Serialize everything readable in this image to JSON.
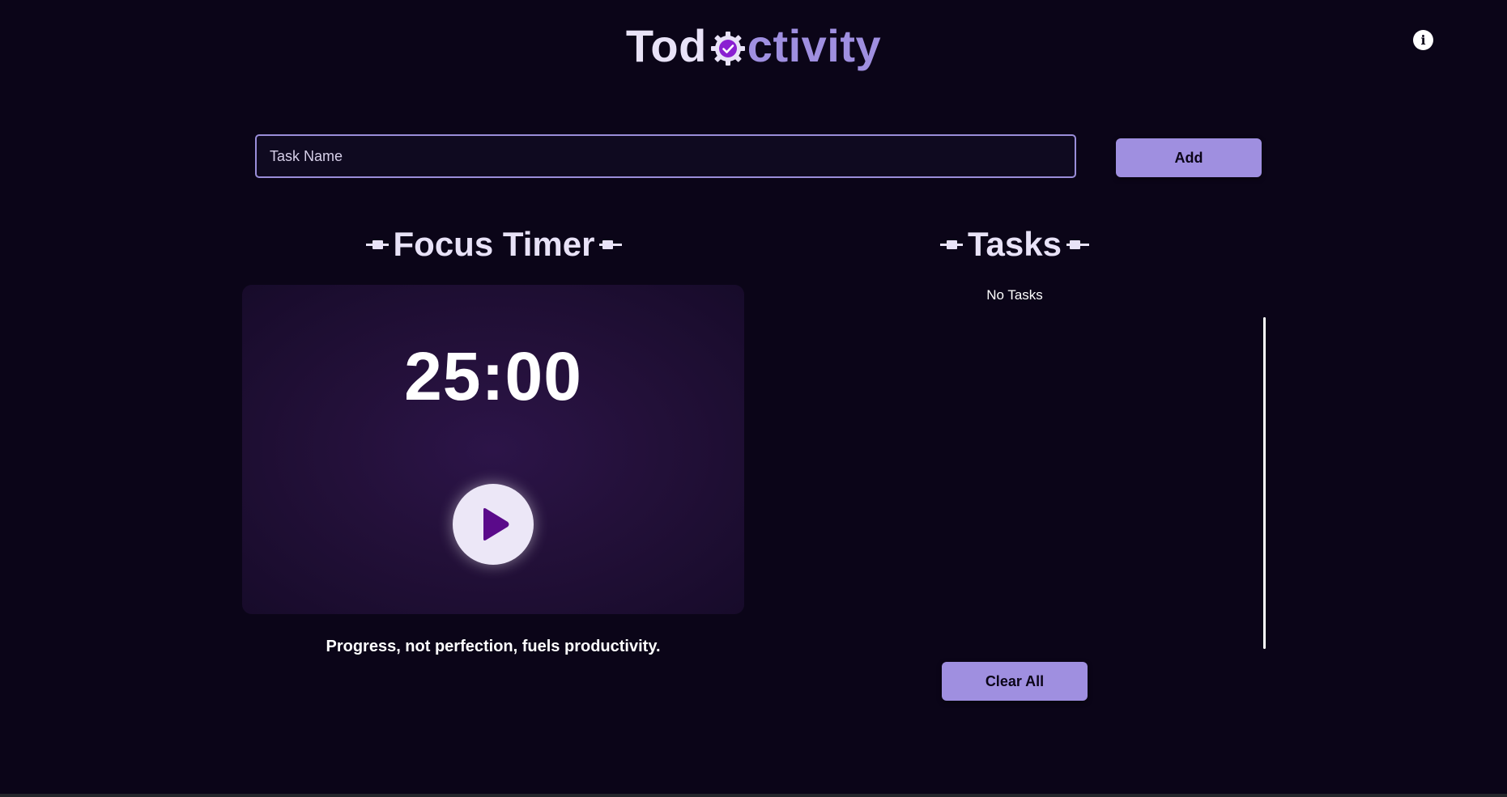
{
  "header": {
    "logo_part_a": "Tod",
    "logo_part_b": "ctivity",
    "logo_icon": "gear-check-icon",
    "info_icon": "info-icon",
    "info_glyph": "i"
  },
  "task_form": {
    "placeholder": "Task Name",
    "value": "",
    "add_label": "Add"
  },
  "focus_timer": {
    "heading": "Focus Timer",
    "time": "25:00",
    "play_icon": "play-icon",
    "quote": "Progress, not perfection, fuels productivity."
  },
  "tasks": {
    "heading": "Tasks",
    "empty_message": "No Tasks",
    "clear_label": "Clear All"
  },
  "colors": {
    "background": "#0b0518",
    "accent": "#9f8fe0",
    "play_purple": "#5a0a8a",
    "heading_text": "#e8e2f7"
  }
}
